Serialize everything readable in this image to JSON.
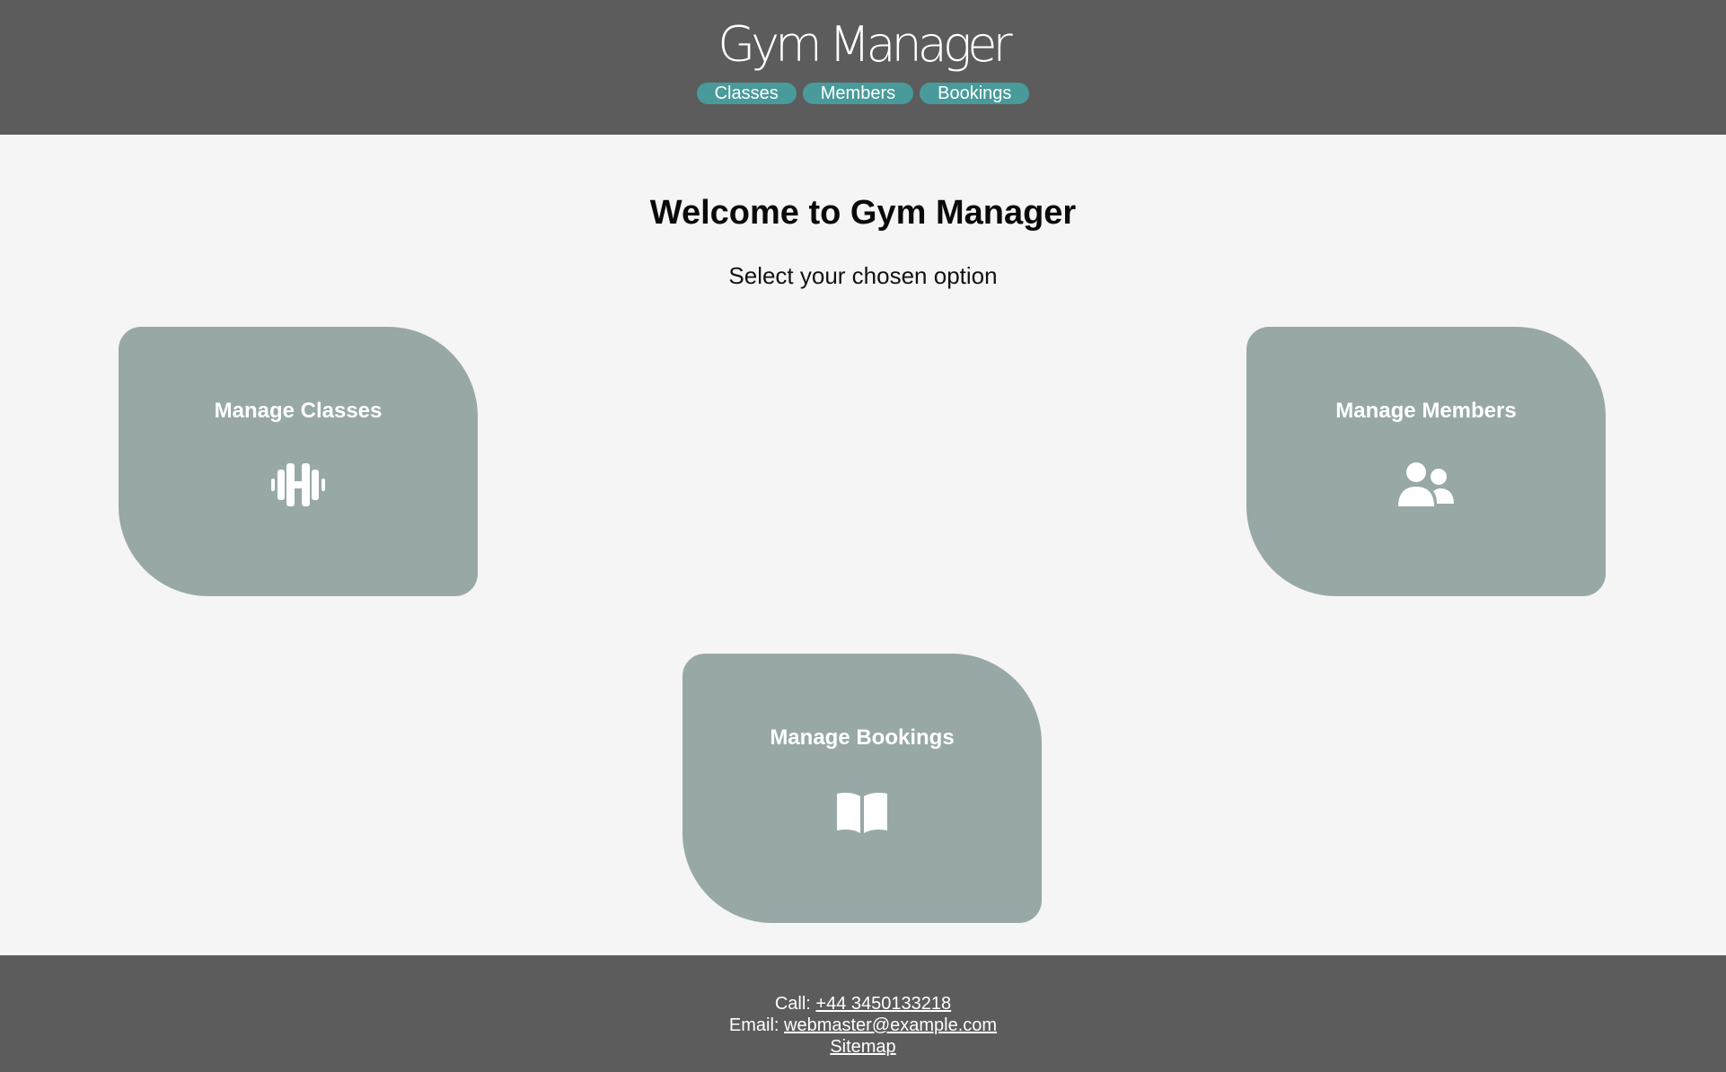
{
  "header": {
    "brand": "Gym Manager",
    "nav": [
      {
        "label": "Classes"
      },
      {
        "label": "Members"
      },
      {
        "label": "Bookings"
      }
    ]
  },
  "main": {
    "heading": "Welcome to Gym Manager",
    "subtitle": "Select your chosen option",
    "cards": [
      {
        "title": "Manage Classes",
        "icon": "dumbbell-icon"
      },
      {
        "title": "Manage Members",
        "icon": "users-icon"
      },
      {
        "title": "Manage Bookings",
        "icon": "book-open-icon"
      }
    ]
  },
  "footer": {
    "call_label": "Call:",
    "phone": "+44 3450133218",
    "email_label": "Email:",
    "email": "webmaster@example.com",
    "sitemap": "Sitemap"
  },
  "colors": {
    "header_bg": "#5c5c5c",
    "nav_pill": "#489b9a",
    "card_bg": "#97a8a7",
    "page_bg": "#f5f5f5"
  }
}
